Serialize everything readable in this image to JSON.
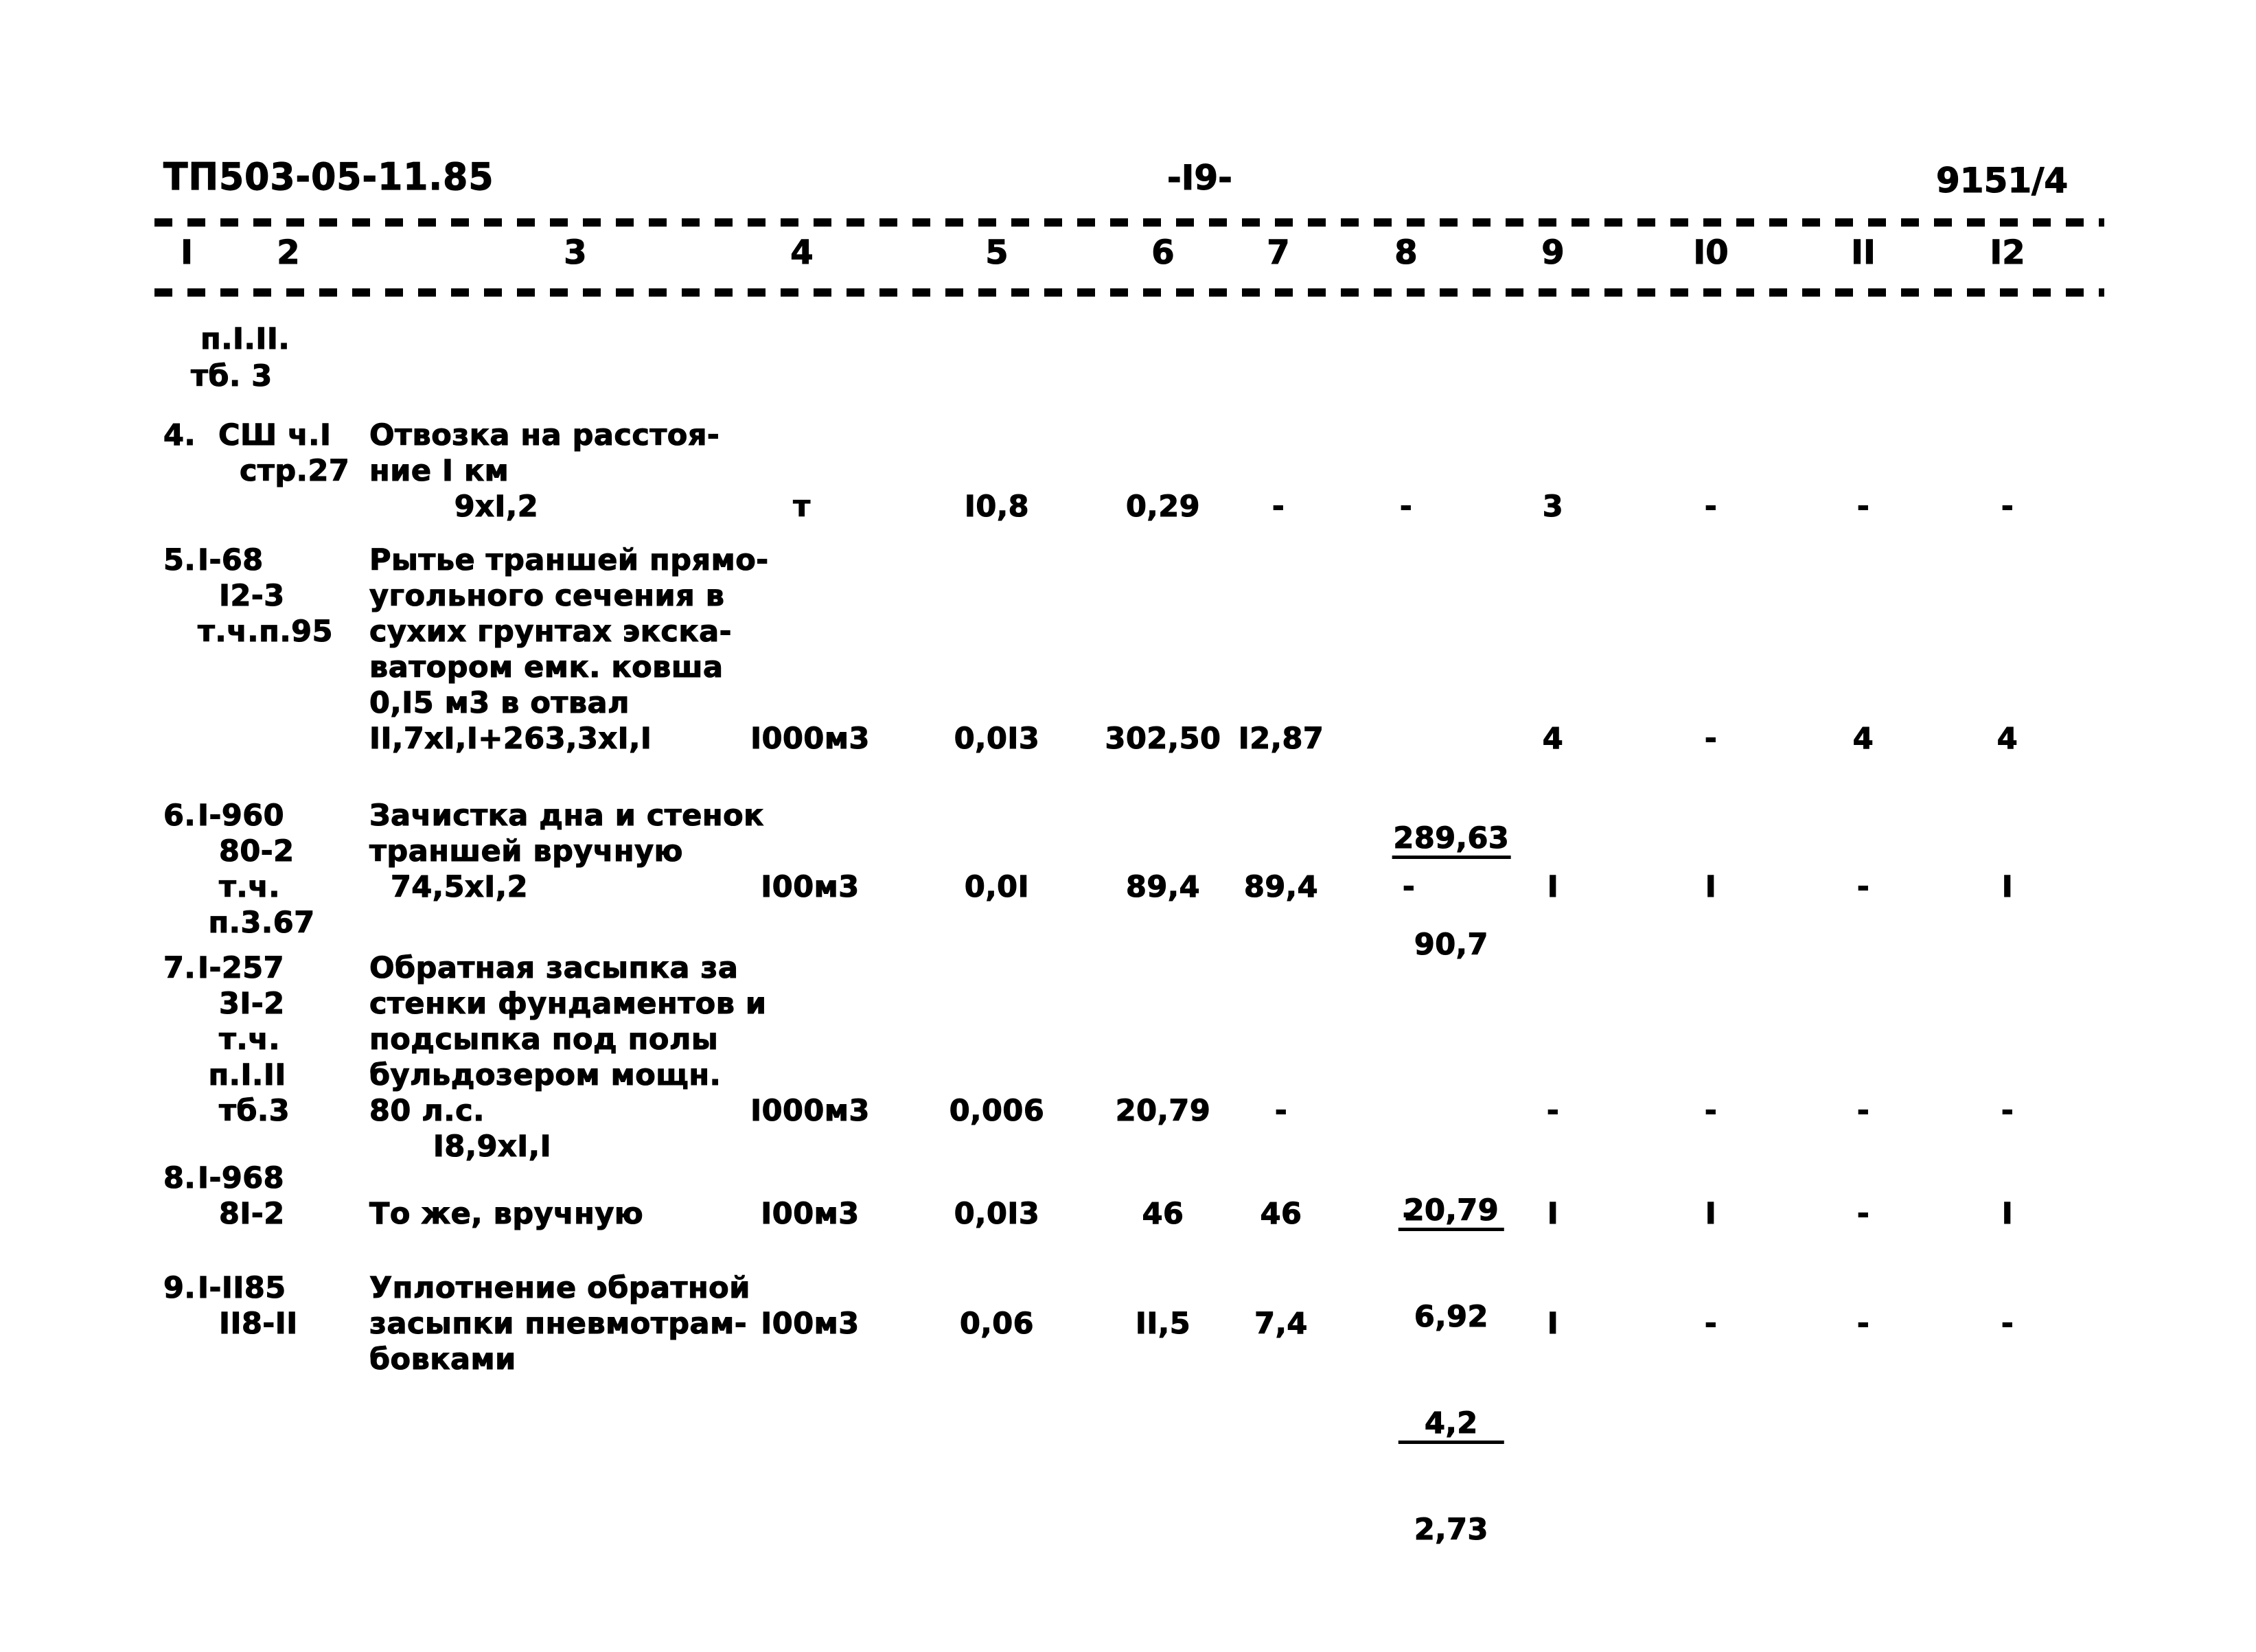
{
  "document": {
    "header_code": "ТП503-05-11.85",
    "page_number": "-I9-",
    "sheet_number": "9151/4"
  },
  "table": {
    "column_numbers": [
      "I",
      "2",
      "3",
      "4",
      "5",
      "6",
      "7",
      "8",
      "9",
      "I0",
      "II",
      "I2"
    ],
    "continuation_note": {
      "line1": "п.I.II.",
      "line2": "тб. 3"
    },
    "rows": [
      {
        "id": "row-4",
        "col1": "4.",
        "col2": "СШ ч.I\n  стр.27",
        "col3": "Отвозка на расстоя-\nние I км\n        9хI,2",
        "col4": "т",
        "col5": "I0,8",
        "col6": "0,29",
        "col7": "-",
        "col8": "-",
        "col9": "3",
        "col10": "-",
        "col11": "-",
        "col12": "-"
      },
      {
        "id": "row-5",
        "col1": "5.",
        "col2": "I-68\n  I2-3\nт.ч.п.95",
        "col3": "Рытье траншей прямо-\nугольного сечения в\nсухих грунтах экска-\nватором емк. ковша\n0,I5 м3 в отвал\nII,7хI,I+263,3хI,I",
        "col4": "I000м3",
        "col5": "0,0I3",
        "col6": "302,50",
        "col7": "I2,87",
        "col8_top": "289,63",
        "col8_bot": "90,7",
        "col9": "4",
        "col10": "-",
        "col11": "4",
        "col12": "4"
      },
      {
        "id": "row-6",
        "col1": "6.",
        "col2": "I-960\n  80-2\n  т.ч.\n п.3.67",
        "col3": "Зачистка дна и стенок\nтраншей вручную\n  74,5хI,2",
        "col4": "I00м3",
        "col5": "0,0I",
        "col6": "89,4",
        "col7": "89,4",
        "col8": "-",
        "col9": "I",
        "col10": "I",
        "col11": "-",
        "col12": "I"
      },
      {
        "id": "row-7",
        "col1": "7.",
        "col2": "I-257\n  3I-2\n  т.ч.\n п.I.II\n  тб.3",
        "col3": "Обратная засыпка за\nстенки фундаментов и\nподсыпка под полы\nбульдозером мощн.\n80 л.с.\n      I8,9хI,I",
        "col4": "I000м3",
        "col5": "0,006",
        "col6": "20,79",
        "col7": "-",
        "col8_top": "20,79",
        "col8_bot": "6,92",
        "col9": "-",
        "col10": "-",
        "col11": "-",
        "col12": "-"
      },
      {
        "id": "row-8",
        "col1": "8.",
        "col2": "I-968\n  8I-2",
        "col3": "То же, вручную",
        "col4": "I00м3",
        "col5": "0,0I3",
        "col6": "46",
        "col7": "46",
        "col8": "-",
        "col9": "I",
        "col10": "I",
        "col11": "-",
        "col12": "I"
      },
      {
        "id": "row-9",
        "col1": "9.",
        "col2": "I-II85\n  II8-II",
        "col3": "Уплотнение обратной\nзасыпки пневмотрам-\nбовками",
        "col4": "I00м3",
        "col5": "0,06",
        "col6": "II,5",
        "col7": "7,4",
        "col8_top": "4,2",
        "col8_bot": "2,73",
        "col9": "I",
        "col10": "-",
        "col11": "-",
        "col12": "-"
      }
    ]
  }
}
